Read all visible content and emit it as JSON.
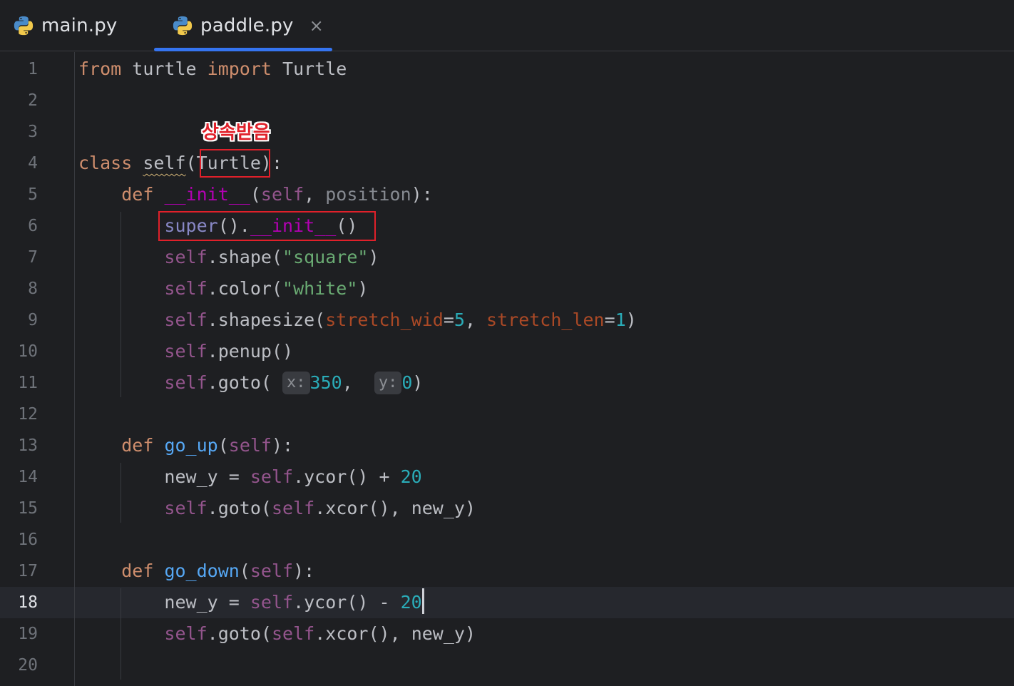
{
  "tabs": [
    {
      "label": "main.py",
      "icon": "python-icon",
      "active": false
    },
    {
      "label": "paddle.py",
      "icon": "python-icon",
      "active": true,
      "close": "×"
    }
  ],
  "colors": {
    "accent": "#3574f0",
    "keyword": "#cf8e6d",
    "self": "#94558d",
    "string": "#6aab73",
    "number": "#2aacb8",
    "function": "#56a8f5",
    "annotation": "#e0202a"
  },
  "editor": {
    "current_line": 18,
    "line_numbers": [
      "1",
      "2",
      "3",
      "4",
      "5",
      "6",
      "7",
      "8",
      "9",
      "10",
      "11",
      "12",
      "13",
      "14",
      "15",
      "16",
      "17",
      "18",
      "19",
      "20"
    ],
    "code": {
      "l1": {
        "from": "from",
        "module": "turtle",
        "import": "import",
        "name": "Turtle"
      },
      "l4": {
        "class": "class",
        "name": "self",
        "base": "Turtle"
      },
      "l5": {
        "def": "def",
        "name": "__init__",
        "self": "self",
        "param": "position"
      },
      "l6": {
        "super": "super",
        "init": "__init__"
      },
      "l7": {
        "self": "self",
        "method": "shape",
        "arg": "\"square\""
      },
      "l8": {
        "self": "self",
        "method": "color",
        "arg": "\"white\""
      },
      "l9": {
        "self": "self",
        "method": "shapesize",
        "k1": "stretch_wid",
        "v1": "5",
        "k2": "stretch_len",
        "v2": "1"
      },
      "l10": {
        "self": "self",
        "method": "penup"
      },
      "l11": {
        "self": "self",
        "method": "goto",
        "hint_x": "x:",
        "v_x": "350",
        "hint_y": "y:",
        "v_y": "0"
      },
      "l13": {
        "def": "def",
        "name": "go_up",
        "self": "self"
      },
      "l14": {
        "var": "new_y",
        "self": "self",
        "method": "ycor",
        "op": "+",
        "num": "20"
      },
      "l15": {
        "self": "self",
        "method": "goto",
        "self2": "self",
        "method2": "xcor",
        "var": "new_y"
      },
      "l17": {
        "def": "def",
        "name": "go_down",
        "self": "self"
      },
      "l18": {
        "var": "new_y",
        "self": "self",
        "method": "ycor",
        "op": "-",
        "num": "20"
      },
      "l19": {
        "self": "self",
        "method": "goto",
        "self2": "self",
        "method2": "xcor",
        "var": "new_y"
      }
    }
  },
  "annotation": {
    "label": "상속받음"
  }
}
